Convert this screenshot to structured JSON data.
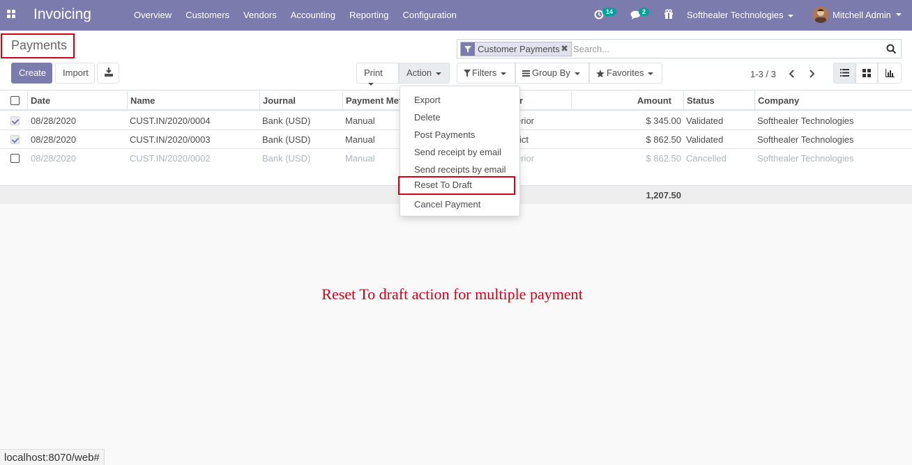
{
  "navbar": {
    "app_name": "Invoicing",
    "menu": [
      "Overview",
      "Customers",
      "Vendors",
      "Accounting",
      "Reporting",
      "Configuration"
    ],
    "activity_count": "14",
    "message_count": "2",
    "company": "Softhealer Technologies",
    "user": "Mitchell Admin",
    "icons": [
      "apps-icon",
      "activity-icon",
      "messages-icon",
      "gift-icon",
      "avatar"
    ]
  },
  "control_panel": {
    "breadcrumb": "Payments",
    "buttons": {
      "create": "Create",
      "import": "Import",
      "print": "Print",
      "action": "Action",
      "filters": "Filters",
      "group_by": "Group By",
      "favorites": "Favorites"
    },
    "search": {
      "facet": "Customer Payments",
      "placeholder": "Search..."
    },
    "pager": "1-3 / 3",
    "views": [
      "list-view-icon",
      "kanban-view-icon",
      "graph-view-icon"
    ]
  },
  "table": {
    "columns": [
      "Date",
      "Name",
      "Journal",
      "Payment Met",
      "r",
      "Amount",
      "Status",
      "Company"
    ],
    "rows": [
      {
        "date": "08/28/2020",
        "name": "CUST.IN/2020/0004",
        "journal": "Bank (USD)",
        "method": "Manual",
        "partner": "erior",
        "amount": "$ 345.00",
        "status": "Validated",
        "company": "Softhealer Technologies",
        "checked": true,
        "cancelled": false
      },
      {
        "date": "08/28/2020",
        "name": "CUST.IN/2020/0003",
        "journal": "Bank (USD)",
        "method": "Manual",
        "partner": "ict",
        "amount": "$ 862.50",
        "status": "Validated",
        "company": "Softhealer Technologies",
        "checked": true,
        "cancelled": false
      },
      {
        "date": "08/28/2020",
        "name": "CUST.IN/2020/0002",
        "journal": "Bank (USD)",
        "method": "Manual",
        "partner": "erior",
        "amount": "$ 862.50",
        "status": "Cancelled",
        "company": "Softhealer Technologies",
        "checked": false,
        "cancelled": true
      }
    ],
    "total": "1,207.50"
  },
  "action_menu": {
    "items": [
      "Export",
      "Delete",
      "Post Payments",
      "Send receipt by email",
      "Send receipts by email",
      "Reset To Draft",
      "Cancel Payment"
    ],
    "highlighted": "Reset To Draft"
  },
  "annotation": "Reset To draft action for multiple payment",
  "status_url": "localhost:8070/web#",
  "colors": {
    "brand": "#7c7bad",
    "highlight": "#d0021b",
    "badge": "#00a09d"
  }
}
